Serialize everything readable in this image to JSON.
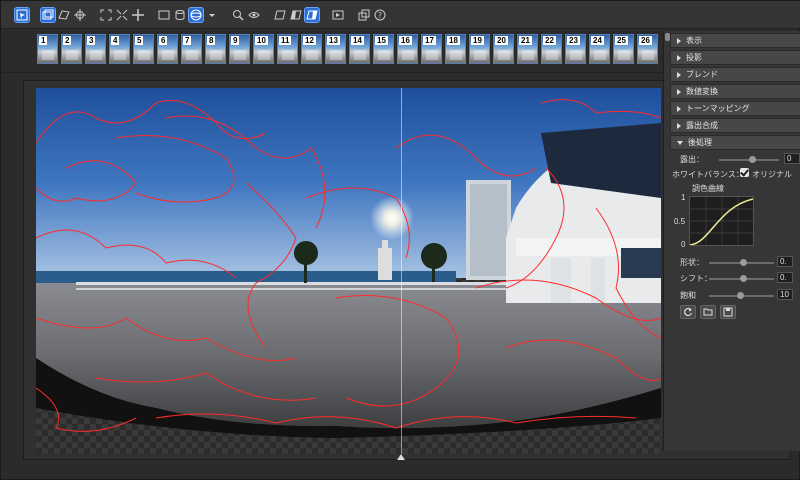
{
  "toolbar": {
    "icons": [
      "select-icon",
      "window-icon",
      "ellipse-window-icon",
      "crosshair-icon",
      "fit-icon",
      "shrink-icon",
      "center-icon",
      "rect-icon",
      "cylinder-icon",
      "sphere-icon",
      "dropdown-icon",
      "zoom-icon",
      "eye-icon",
      "view-normal-icon",
      "view-split-icon",
      "view-overlay-icon",
      "camera-icon",
      "layers-icon",
      "help-icon"
    ]
  },
  "filmstrip": {
    "frames": [
      "1",
      "2",
      "3",
      "4",
      "5",
      "6",
      "7",
      "8",
      "9",
      "10",
      "11",
      "12",
      "13",
      "14",
      "15",
      "16",
      "17",
      "18",
      "19",
      "20",
      "21",
      "22",
      "23",
      "24",
      "25",
      "26"
    ]
  },
  "panel": {
    "sections": {
      "display": "表示",
      "projection": "投影",
      "blend": "ブレンド",
      "numeric": "数値変換",
      "tonemap": "トーンマッピング",
      "exposure_merge": "露出合成",
      "postprocess": "後処理"
    },
    "exposure_label": "露出：",
    "exposure_value": "0",
    "white_balance_label": "ホワイトバランス：",
    "white_balance_option": "オリジナル",
    "tone_curve_label": "調色曲線",
    "curve_axis_top": "1",
    "curve_axis_mid": "0.5",
    "curve_axis_bottom": "0",
    "shape_label": "形状：",
    "shape_value": "0.",
    "shift_label": "シフト：",
    "shift_value": "0.",
    "saturation_label": "飽和",
    "saturation_value": "10"
  },
  "colors": {
    "accent": "#2b6fd6",
    "seam_lines": "#ff2a2a"
  }
}
